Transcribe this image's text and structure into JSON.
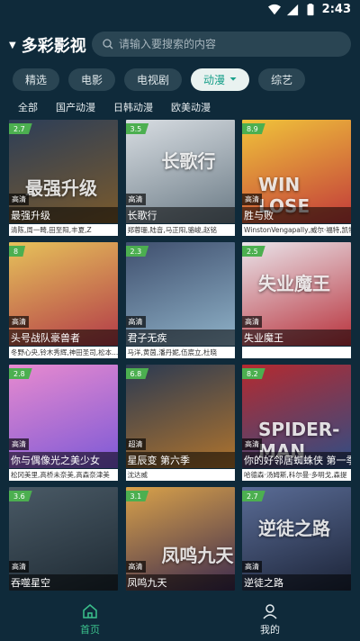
{
  "status": {
    "time": "2:43"
  },
  "header": {
    "title": "多彩影视",
    "search_placeholder": "请输入要搜索的内容"
  },
  "tabs": [
    {
      "label": "精选"
    },
    {
      "label": "电影"
    },
    {
      "label": "电视剧"
    },
    {
      "label": "动漫"
    },
    {
      "label": "综艺"
    }
  ],
  "subtabs": [
    {
      "label": "全部"
    },
    {
      "label": "国产动漫"
    },
    {
      "label": "日韩动漫"
    },
    {
      "label": "欧美动漫"
    }
  ],
  "cards": [
    {
      "score": "2.7",
      "quality": "高清",
      "title": "最强升级",
      "cast": "清陈,周一畸,田至阳,丰夏,Z",
      "color1": "#2c3e58",
      "color2": "#7a5a2c"
    },
    {
      "score": "3.5",
      "quality": "高清",
      "title": "长歌行",
      "cast": "郑蓉珊,陆音,马正阳,骆峻,赵铭",
      "color1": "#d8dde2",
      "color2": "#6b7b86"
    },
    {
      "score": "8.9",
      "quality": "高清",
      "title": "胜与败",
      "cast": "WinstonVengapally,威尔·福特,凯特",
      "color1": "#f0c43a",
      "color2": "#c23a3a"
    },
    {
      "score": "8",
      "quality": "高清",
      "title": "头号战队豪兽者",
      "cast": "冬野心央,铃木秀辉,神田圣司,松本...",
      "color1": "#e6c25a",
      "color2": "#b23a48"
    },
    {
      "score": "2.3",
      "quality": "高清",
      "title": "君子无疾",
      "cast": "马洋,黄茵,潘丹妮,伍宸立,杜晓",
      "color1": "#3f4f6e",
      "color2": "#8fb2c8"
    },
    {
      "score": "2.5",
      "quality": "高清",
      "title": "失业魔王",
      "cast": "",
      "color1": "#e9e4ea",
      "color2": "#b8323c"
    },
    {
      "score": "2.8",
      "quality": "高清",
      "title": "你与偶像光之美少女",
      "cast": "松冈美里,高桥未奈美,高森奈津美",
      "color1": "#e88acf",
      "color2": "#7c59d6"
    },
    {
      "score": "6.8",
      "quality": "超清",
      "title": "星辰变 第六季",
      "cast": "沈达威",
      "color1": "#2b3a52",
      "color2": "#b0742d"
    },
    {
      "score": "8.2",
      "quality": "高清",
      "title": "你的好邻居蜘蛛侠 第一季",
      "cast": "哈德森·汤姆斯,科尔曼·多明戈,森提",
      "color1": "#b52a2f",
      "color2": "#2e4e86"
    },
    {
      "score": "3.6",
      "quality": "高清",
      "title": "吞噬星空",
      "cast": "",
      "color1": "#4a5a66",
      "color2": "#1e2a33"
    },
    {
      "score": "3.1",
      "quality": "高清",
      "title": "凤鸣九天",
      "cast": "",
      "color1": "#d9a24a",
      "color2": "#3c2a4e"
    },
    {
      "score": "2.7",
      "quality": "高清",
      "title": "逆徒之路",
      "cast": "",
      "color1": "#5a6c96",
      "color2": "#1c2438"
    }
  ],
  "poster_text": [
    "最强升级",
    "长歌行",
    "WIN LOSE",
    "",
    "",
    "失业魔王",
    "",
    "",
    "SPIDER-MAN",
    "",
    "凤鸣九天",
    "逆徒之路"
  ],
  "bottom_nav": [
    {
      "label": "首页"
    },
    {
      "label": "我的"
    }
  ]
}
